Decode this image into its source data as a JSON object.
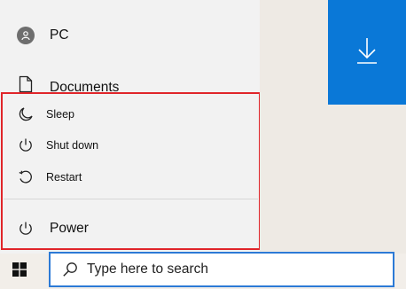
{
  "start_menu": {
    "user": {
      "label": "PC",
      "icon": "user-avatar-icon"
    },
    "documents": {
      "label": "Documents",
      "icon": "document-icon"
    },
    "power_menu": {
      "items": [
        {
          "label": "Sleep",
          "icon": "moon-icon"
        },
        {
          "label": "Shut down",
          "icon": "power-icon"
        },
        {
          "label": "Restart",
          "icon": "restart-icon"
        }
      ]
    },
    "power": {
      "label": "Power",
      "icon": "power-icon"
    }
  },
  "tiles": {
    "download": {
      "icon": "download-arrow-icon"
    }
  },
  "taskbar": {
    "start_icon": "windows-logo-icon",
    "search": {
      "placeholder": "Type here to search",
      "icon": "search-icon"
    }
  },
  "colors": {
    "tile_blue": "#0a78d7",
    "highlight_red": "#e0252a",
    "search_border": "#2c7ad6"
  }
}
